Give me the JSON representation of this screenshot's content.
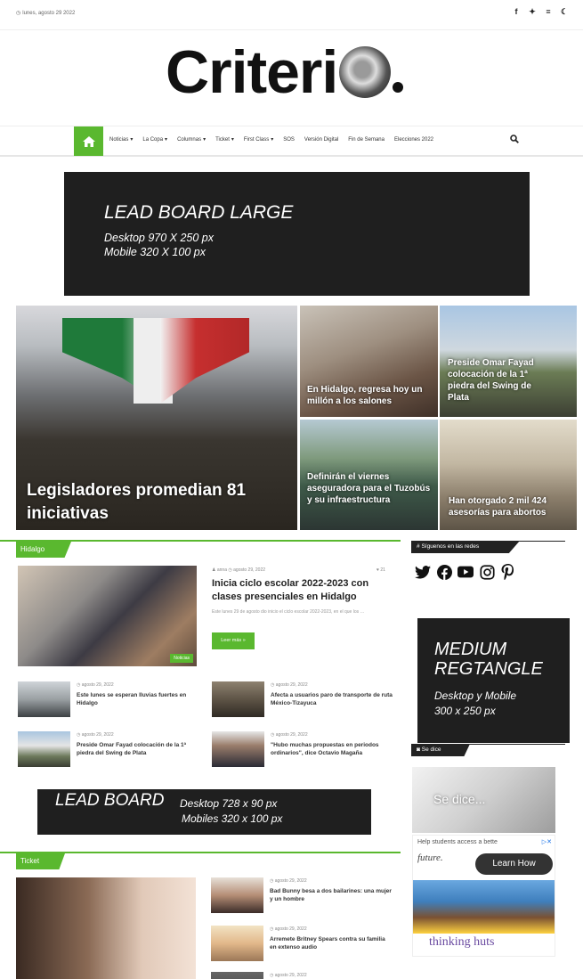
{
  "topbar": {
    "date": "lunes, agosto 29 2022",
    "icons": [
      "facebook-icon",
      "twitter-icon",
      "menu-icon",
      "moon-icon"
    ]
  },
  "logo": {
    "text": "Criteri",
    "dot": "."
  },
  "nav": {
    "items": [
      {
        "label": "Noticias",
        "caret": "▾"
      },
      {
        "label": "La Copa",
        "caret": "▾"
      },
      {
        "label": "Columnas",
        "caret": "▾"
      },
      {
        "label": "Ticket",
        "caret": "▾"
      },
      {
        "label": "First Class",
        "caret": "▾"
      },
      {
        "label": "SOS",
        "caret": ""
      },
      {
        "label": "Versión Digital",
        "caret": ""
      },
      {
        "label": "Fin de Semana",
        "caret": ""
      },
      {
        "label": "Elecciones 2022",
        "caret": ""
      }
    ]
  },
  "ads": {
    "lead_large": {
      "title": "LEAD BOARD LARGE",
      "line1": "Desktop 970 X 250 px",
      "line2": "Mobile 320 X 100 px"
    },
    "lead": {
      "title": "LEAD BOARD",
      "line1": "Desktop  728 x 90 px",
      "line2": "Mobiles  320 x 100 px"
    },
    "medium": {
      "title1": "MEDIUM",
      "title2": "REGTANGLE",
      "line1": "Desktop y Mobile",
      "line2": "300 x 250 px"
    }
  },
  "hero": {
    "big": "Legisladores promedian 81 iniciativas",
    "t2": "En Hidalgo, regresa hoy un millón a los salones",
    "t3": "Preside Omar Fayad colocación de la 1ª piedra del Swing de Plata",
    "t4": "Definirán el viernes aseguradora para el Tuzobús y su infraestructura",
    "t5": "Han otorgado 2 mil 424 asesorías para abortos"
  },
  "hidalgo": {
    "label": "Hidalgo",
    "featured": {
      "meta": "♟ anna  ◷ agosto 29, 2022",
      "comments": "♥ 21",
      "title": "Inicia ciclo escolar 2022-2023 con clases presenciales en Hidalgo",
      "excerpt": "Este lunes 29 de agosto dio inicio el ciclo escolar 2022-2023, en el que los …",
      "button": "Leer más »",
      "badge": "Noticias"
    },
    "items": [
      {
        "meta": "◷ agosto 29, 2022",
        "title": "Este lunes se esperan lluvias fuertes en Hidalgo"
      },
      {
        "meta": "◷ agosto 29, 2022",
        "title": "Afecta a usuarios paro de transporte de ruta México-Tizayuca"
      },
      {
        "meta": "◷ agosto 29, 2022",
        "title": "Preside Omar Fayad colocación de la 1ª piedra del Swing de Plata"
      },
      {
        "meta": "◷ agosto 29, 2022",
        "title": "\"Hubo muchas propuestas en periodos ordinarios\", dice Octavio Magaña"
      }
    ]
  },
  "sidebar": {
    "follow_label": "Síguenos en las redes",
    "socials": [
      "twitter-icon",
      "facebook-icon",
      "youtube-icon",
      "instagram-icon",
      "pinterest-icon"
    ],
    "sedice_label": "Se dice",
    "sedice_text": "Se dice...",
    "ad": {
      "help": "Help students access a bette",
      "future": "future.",
      "learn": "Learn How",
      "brand": "thinking huts"
    }
  },
  "ticket": {
    "label": "Ticket",
    "items": [
      {
        "meta": "◷ agosto 29, 2022",
        "title": "Bad Bunny besa a dos bailarines: una mujer y un hombre"
      },
      {
        "meta": "◷ agosto 29, 2022",
        "title": "Arremete Britney Spears contra su familia en extenso audio"
      },
      {
        "meta": "◷ agosto 29, 2022",
        "title": ""
      }
    ]
  },
  "colors": {
    "accent": "#5ab82f",
    "dark": "#1f1f1f"
  }
}
